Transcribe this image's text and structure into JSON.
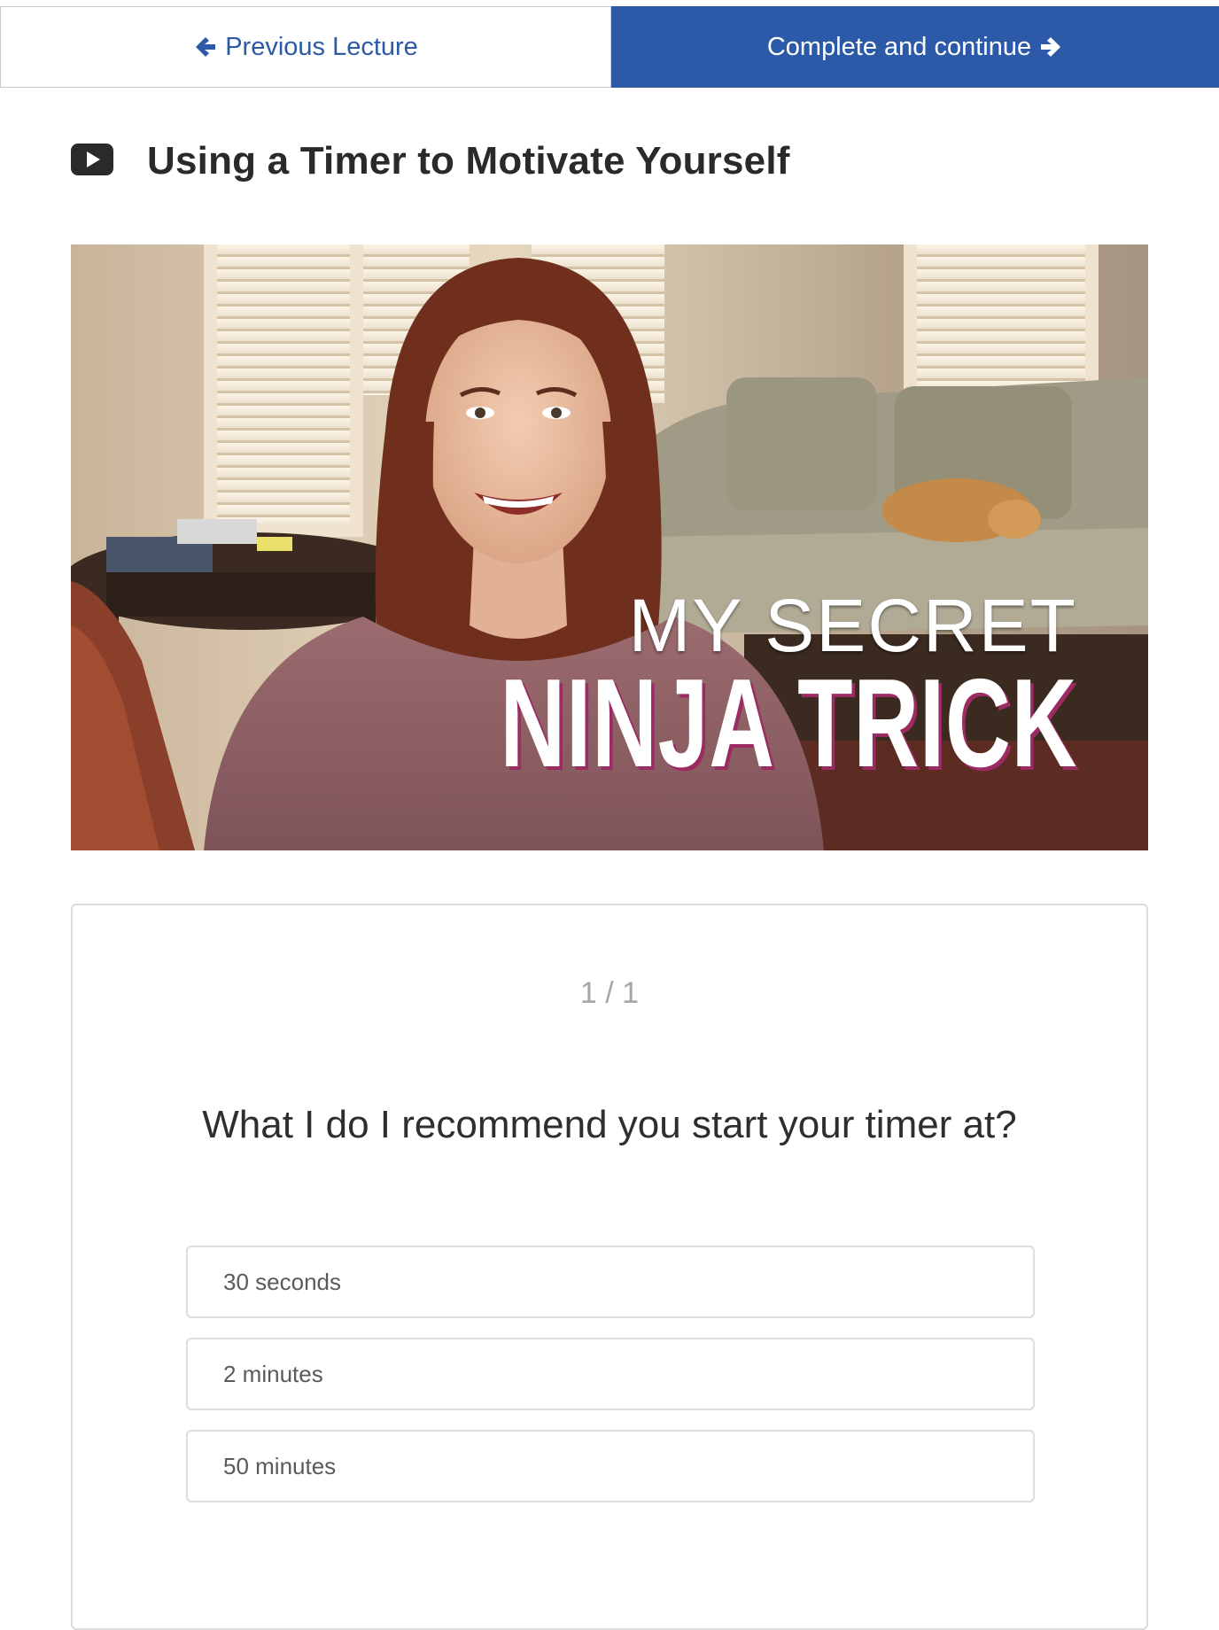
{
  "nav": {
    "previous_label": "Previous Lecture",
    "complete_label": "Complete and continue",
    "previous_icon": "arrow-left-icon",
    "complete_icon": "arrow-right-icon"
  },
  "lecture": {
    "icon": "video-icon",
    "title": "Using a Timer to Motivate Yourself"
  },
  "video": {
    "caption_line_1": "MY SECRET",
    "caption_line_2": "NINJA TRICK"
  },
  "quiz": {
    "progress": "1 / 1",
    "question": "What I do I recommend you start your timer at?",
    "options": [
      {
        "label": "30 seconds"
      },
      {
        "label": "2 minutes"
      },
      {
        "label": "50 minutes"
      }
    ]
  },
  "colors": {
    "accent": "#2c5aa8",
    "link": "#2c5aa6",
    "border": "#dcdcdc",
    "caption_shadow": "#9c2a63"
  }
}
